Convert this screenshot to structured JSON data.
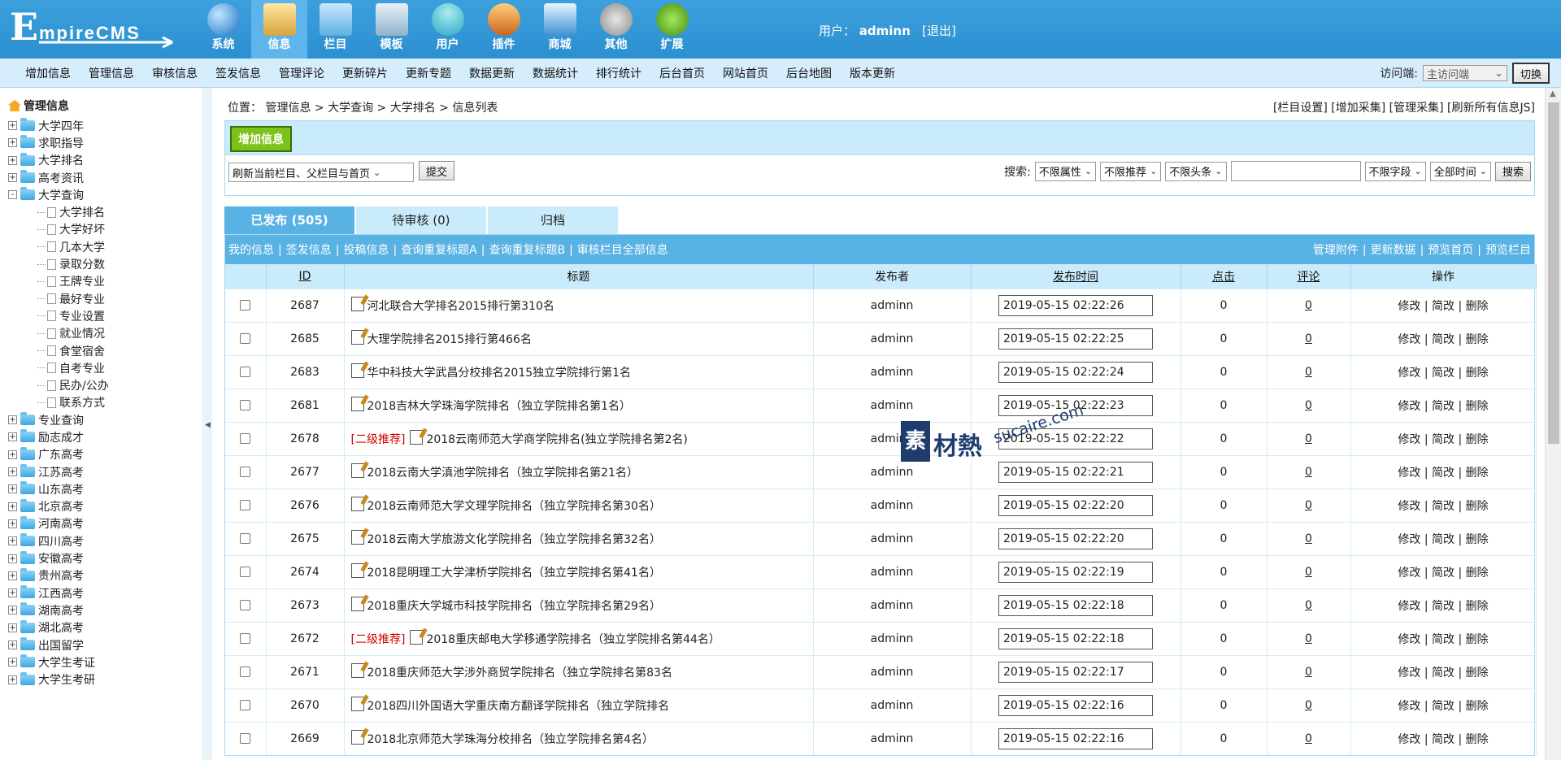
{
  "header": {
    "logo_initial": "E",
    "logo_rest": "mpireCMS",
    "modules": [
      {
        "label": "系统",
        "icon": "globe-icon"
      },
      {
        "label": "信息",
        "icon": "notepad-icon",
        "active": true
      },
      {
        "label": "栏目",
        "icon": "folder-icon"
      },
      {
        "label": "模板",
        "icon": "window-icon"
      },
      {
        "label": "用户",
        "icon": "user-icon"
      },
      {
        "label": "插件",
        "icon": "tools-icon"
      },
      {
        "label": "商城",
        "icon": "card-icon"
      },
      {
        "label": "其他",
        "icon": "gear-icon"
      },
      {
        "label": "扩展",
        "icon": "plus-icon"
      }
    ],
    "user_label": "用户：",
    "username": "adminn",
    "logout": "[退出]"
  },
  "menu": {
    "items": [
      "增加信息",
      "管理信息",
      "审核信息",
      "签发信息",
      "管理评论",
      "更新碎片",
      "更新专题",
      "数据更新",
      "数据统计",
      "排行统计",
      "后台首页",
      "网站首页",
      "后台地图",
      "版本更新"
    ],
    "visit_label": "访问端:",
    "visit_value": "主访问端",
    "switch_label": "切换"
  },
  "sidebar": {
    "title": "管理信息",
    "tree": [
      {
        "label": "大学四年",
        "level": 0,
        "state": "+"
      },
      {
        "label": "求职指导",
        "level": 0,
        "state": "+"
      },
      {
        "label": "大学排名",
        "level": 0,
        "state": "+"
      },
      {
        "label": "高考资讯",
        "level": 0,
        "state": "+"
      },
      {
        "label": "大学查询",
        "level": 0,
        "state": "-"
      },
      {
        "label": "大学排名",
        "level": 1
      },
      {
        "label": "大学好坏",
        "level": 1
      },
      {
        "label": "几本大学",
        "level": 1
      },
      {
        "label": "录取分数",
        "level": 1
      },
      {
        "label": "王牌专业",
        "level": 1
      },
      {
        "label": "最好专业",
        "level": 1
      },
      {
        "label": "专业设置",
        "level": 1
      },
      {
        "label": "就业情况",
        "level": 1
      },
      {
        "label": "食堂宿舍",
        "level": 1
      },
      {
        "label": "自考专业",
        "level": 1
      },
      {
        "label": "民办/公办",
        "level": 1
      },
      {
        "label": "联系方式",
        "level": 1
      },
      {
        "label": "专业查询",
        "level": 0,
        "state": "+"
      },
      {
        "label": "励志成才",
        "level": 0,
        "state": "+"
      },
      {
        "label": "广东高考",
        "level": 0,
        "state": "+"
      },
      {
        "label": "江苏高考",
        "level": 0,
        "state": "+"
      },
      {
        "label": "山东高考",
        "level": 0,
        "state": "+"
      },
      {
        "label": "北京高考",
        "level": 0,
        "state": "+"
      },
      {
        "label": "河南高考",
        "level": 0,
        "state": "+"
      },
      {
        "label": "四川高考",
        "level": 0,
        "state": "+"
      },
      {
        "label": "安徽高考",
        "level": 0,
        "state": "+"
      },
      {
        "label": "贵州高考",
        "level": 0,
        "state": "+"
      },
      {
        "label": "江西高考",
        "level": 0,
        "state": "+"
      },
      {
        "label": "湖南高考",
        "level": 0,
        "state": "+"
      },
      {
        "label": "湖北高考",
        "level": 0,
        "state": "+"
      },
      {
        "label": "出国留学",
        "level": 0,
        "state": "+"
      },
      {
        "label": "大学生考证",
        "level": 0,
        "state": "+"
      },
      {
        "label": "大学生考研",
        "level": 0,
        "state": "+"
      }
    ]
  },
  "main": {
    "breadcrumb": "位置： 管理信息 > 大学查询 > 大学排名 > 信息列表",
    "top_links": "[栏目设置] [增加采集] [管理采集] [刷新所有信息JS]",
    "add_button": "增加信息",
    "refresh_select": "刷新当前栏目、父栏目与首页",
    "submit_label": "提交",
    "search_label": "搜索:",
    "filters": [
      "不限属性",
      "不限推荐",
      "不限头条"
    ],
    "keyword_value": "",
    "field_select": "不限字段",
    "time_select": "全部时间",
    "search_button": "搜索",
    "tabs": [
      {
        "label": "已发布 (505)",
        "on": true
      },
      {
        "label": "待审核 (0)",
        "on": false
      },
      {
        "label": "归档",
        "on": false
      }
    ],
    "bar_left": [
      "我的信息",
      "签发信息",
      "投稿信息",
      "查询重复标题A",
      "查询重复标题B",
      "审核栏目全部信息"
    ],
    "bar_right": [
      "管理附件",
      "更新数据",
      "预览首页",
      "预览栏目"
    ],
    "columns": [
      "ID",
      "标题",
      "发布者",
      "发布时间",
      "点击",
      "评论",
      "操作"
    ],
    "ops": [
      "修改",
      "简改",
      "删除"
    ],
    "rows": [
      {
        "id": "2687",
        "rec": "",
        "title": "河北联合大学排名2015排行第310名",
        "author": "adminn",
        "time": "2019-05-15 02:22:26",
        "clicks": "0",
        "comments": "0"
      },
      {
        "id": "2685",
        "rec": "",
        "title": "大理学院排名2015排行第466名",
        "author": "adminn",
        "time": "2019-05-15 02:22:25",
        "clicks": "0",
        "comments": "0"
      },
      {
        "id": "2683",
        "rec": "",
        "title": "华中科技大学武昌分校排名2015独立学院排行第1名",
        "author": "adminn",
        "time": "2019-05-15 02:22:24",
        "clicks": "0",
        "comments": "0"
      },
      {
        "id": "2681",
        "rec": "",
        "title": "2018吉林大学珠海学院排名（独立学院排名第1名）",
        "author": "adminn",
        "time": "2019-05-15 02:22:23",
        "clicks": "0",
        "comments": "0"
      },
      {
        "id": "2678",
        "rec": "[二级推荐]",
        "title": "2018云南师范大学商学院排名(独立学院排名第2名)",
        "author": "adminn",
        "time": "2019-05-15 02:22:22",
        "clicks": "0",
        "comments": "0"
      },
      {
        "id": "2677",
        "rec": "",
        "title": "2018云南大学滇池学院排名（独立学院排名第21名）",
        "author": "adminn",
        "time": "2019-05-15 02:22:21",
        "clicks": "0",
        "comments": "0"
      },
      {
        "id": "2676",
        "rec": "",
        "title": "2018云南师范大学文理学院排名（独立学院排名第30名）",
        "author": "adminn",
        "time": "2019-05-15 02:22:20",
        "clicks": "0",
        "comments": "0"
      },
      {
        "id": "2675",
        "rec": "",
        "title": "2018云南大学旅游文化学院排名（独立学院排名第32名）",
        "author": "adminn",
        "time": "2019-05-15 02:22:20",
        "clicks": "0",
        "comments": "0"
      },
      {
        "id": "2674",
        "rec": "",
        "title": "2018昆明理工大学津桥学院排名（独立学院排名第41名）",
        "author": "adminn",
        "time": "2019-05-15 02:22:19",
        "clicks": "0",
        "comments": "0"
      },
      {
        "id": "2673",
        "rec": "",
        "title": "2018重庆大学城市科技学院排名（独立学院排名第29名）",
        "author": "adminn",
        "time": "2019-05-15 02:22:18",
        "clicks": "0",
        "comments": "0"
      },
      {
        "id": "2672",
        "rec": "[二级推荐]",
        "title": "2018重庆邮电大学移通学院排名（独立学院排名第44名）",
        "author": "adminn",
        "time": "2019-05-15 02:22:18",
        "clicks": "0",
        "comments": "0"
      },
      {
        "id": "2671",
        "rec": "",
        "title": "2018重庆师范大学涉外商贸学院排名（独立学院排名第83名",
        "author": "adminn",
        "time": "2019-05-15 02:22:17",
        "clicks": "0",
        "comments": "0"
      },
      {
        "id": "2670",
        "rec": "",
        "title": "2018四川外国语大学重庆南方翻译学院排名（独立学院排名",
        "author": "adminn",
        "time": "2019-05-15 02:22:16",
        "clicks": "0",
        "comments": "0"
      },
      {
        "id": "2669",
        "rec": "",
        "title": "2018北京师范大学珠海分校排名（独立学院排名第4名）",
        "author": "adminn",
        "time": "2019-05-15 02:22:16",
        "clicks": "0",
        "comments": "0"
      }
    ]
  },
  "watermark": {
    "block": "素",
    "zh": "材熱",
    "en": "sucaire.com"
  },
  "colors": {
    "header": "#3da0dd",
    "menu": "#d6eefb",
    "tab_active": "#58b2e4",
    "light": "#c9ebfb",
    "add_button": "#7cc21a",
    "recommend": "#d40000"
  }
}
